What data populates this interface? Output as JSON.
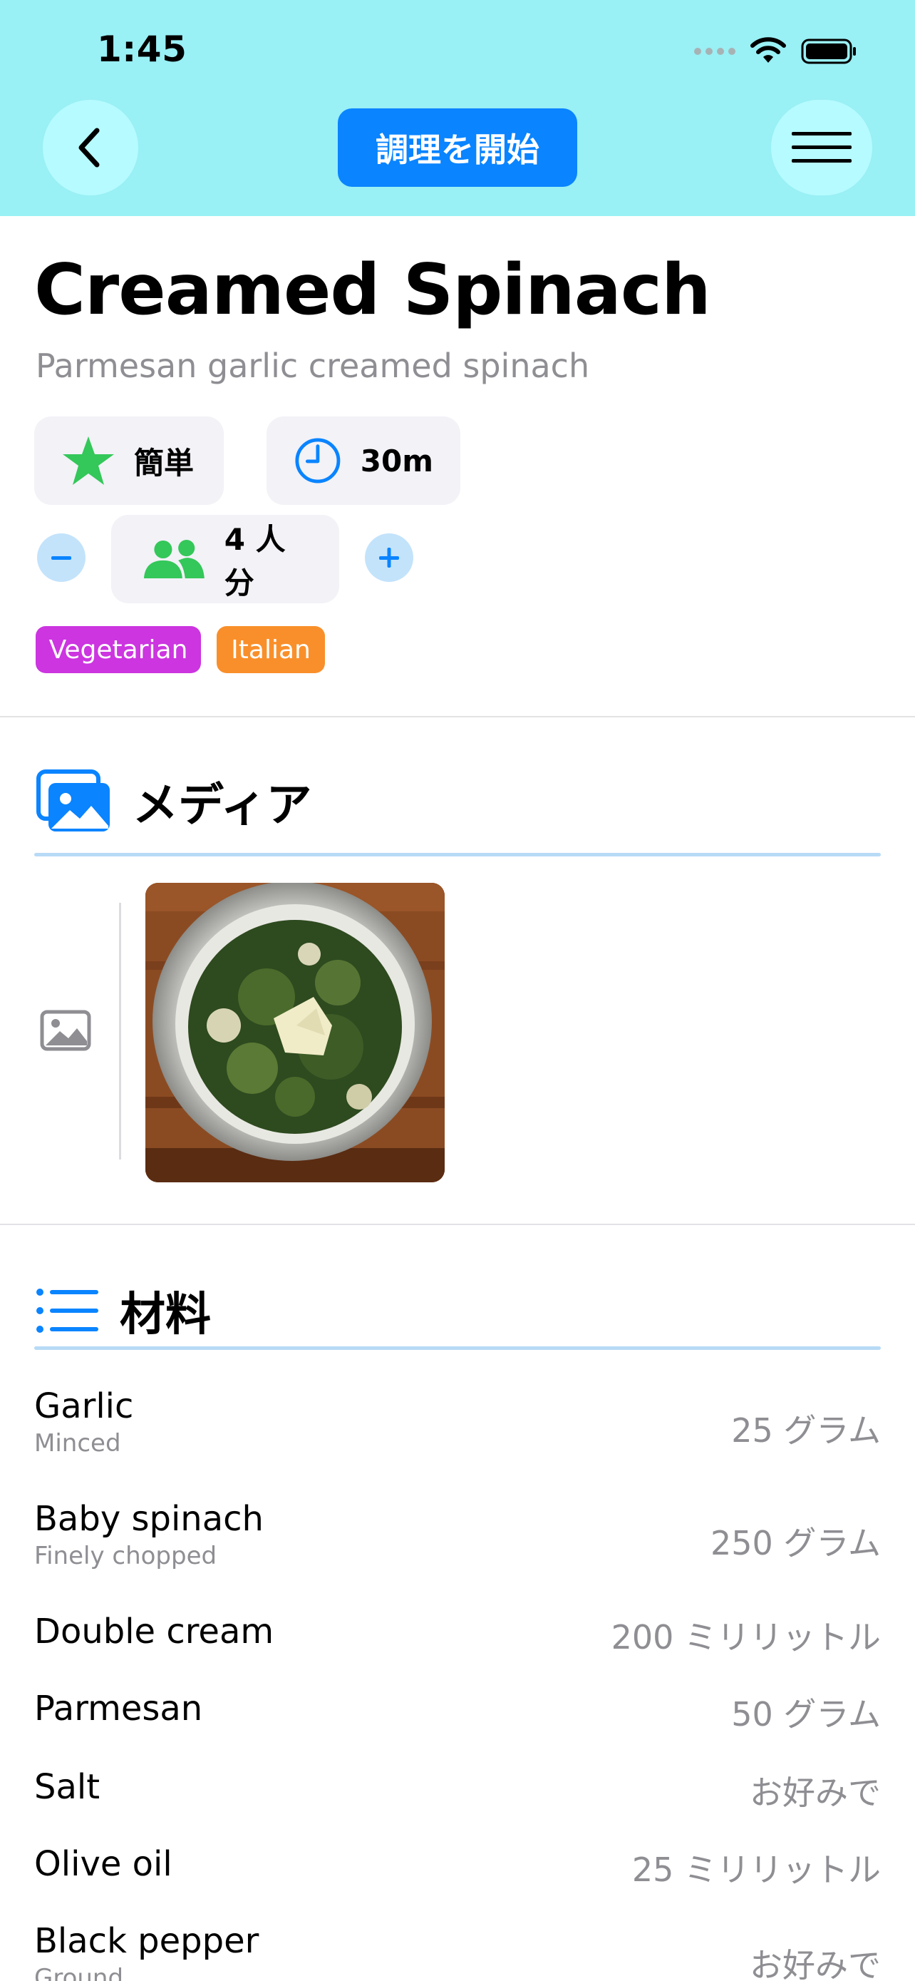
{
  "status_bar": {
    "time": "1:45"
  },
  "header": {
    "start_cooking_label": "調理を開始"
  },
  "recipe": {
    "title": "Creamed Spinach",
    "subtitle": "Parmesan garlic creamed spinach",
    "difficulty": "簡単",
    "time": "30m",
    "servings": "4 人分",
    "tags": [
      {
        "label": "Vegetarian",
        "color": "#cc35e0"
      },
      {
        "label": "Italian",
        "color": "#f98f2a"
      }
    ]
  },
  "media": {
    "title": "メディア"
  },
  "ingredients": {
    "title": "材料",
    "items": [
      {
        "name": "Garlic",
        "note": "Minced",
        "qty": "25 グラム"
      },
      {
        "name": "Baby spinach",
        "note": "Finely chopped",
        "qty": "250 グラム"
      },
      {
        "name": "Double cream",
        "note": "",
        "qty": "200 ミリリットル"
      },
      {
        "name": "Parmesan",
        "note": "",
        "qty": "50 グラム"
      },
      {
        "name": "Salt",
        "note": "",
        "qty": "お好みで"
      },
      {
        "name": "Olive oil",
        "note": "",
        "qty": "25 ミリリットル"
      },
      {
        "name": "Black pepper",
        "note": "Ground",
        "qty": "お好みで"
      }
    ]
  },
  "colors": {
    "header_bg": "#99f0f5",
    "accent_blue": "#0a84ff",
    "star_green": "#34c759"
  }
}
